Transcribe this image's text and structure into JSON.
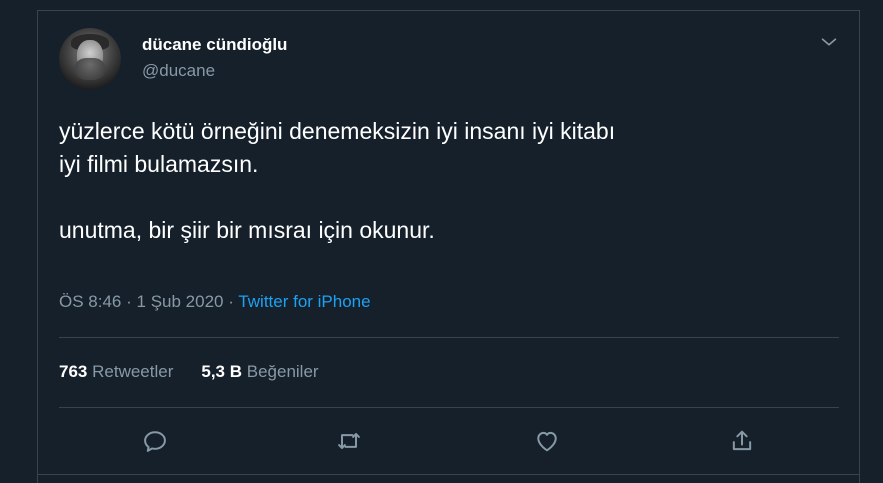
{
  "user": {
    "name": "dücane cündioğlu",
    "handle": "@ducane"
  },
  "tweet": {
    "text": "yüzlerce kötü örneğini denemeksizin iyi insanı iyi kitabı\niyi filmi bulamazsın.\n\nunutma, bir şiir bir mısraı için okunur.",
    "time": "ÖS 8:46",
    "separator": "·",
    "date": "1 Şub 2020",
    "source": "Twitter for iPhone"
  },
  "stats": {
    "retweets_count": "763",
    "retweets_label": "Retweetler",
    "likes_count": "5,3 B",
    "likes_label": "Beğeniler"
  },
  "icons": {
    "caret": "chevron-down-icon",
    "reply": "reply-icon",
    "retweet": "retweet-icon",
    "like": "heart-icon",
    "share": "share-icon"
  },
  "colors": {
    "background": "#15202b",
    "border": "#38444d",
    "secondary_text": "#8899a6",
    "accent": "#1da1f2"
  }
}
